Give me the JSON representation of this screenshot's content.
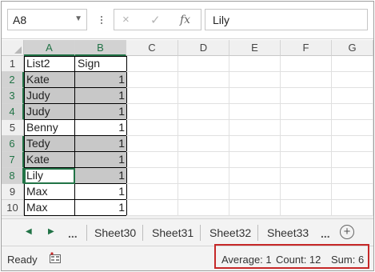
{
  "formula_bar": {
    "name_box": "A8",
    "cancel_icon": "×",
    "enter_icon": "✓",
    "fx_label": "fx",
    "content": "Lily"
  },
  "columns": [
    "A",
    "B",
    "C",
    "D",
    "E",
    "F",
    "G"
  ],
  "rows": [
    {
      "num": "1",
      "a": "List2",
      "b": "Sign",
      "shaded": false
    },
    {
      "num": "2",
      "a": "Kate",
      "b": "1",
      "shaded": true
    },
    {
      "num": "3",
      "a": "Judy",
      "b": "1",
      "shaded": true
    },
    {
      "num": "4",
      "a": "Judy",
      "b": "1",
      "shaded": true
    },
    {
      "num": "5",
      "a": "Benny",
      "b": "1",
      "shaded": false
    },
    {
      "num": "6",
      "a": "Tedy",
      "b": "1",
      "shaded": true
    },
    {
      "num": "7",
      "a": "Kate",
      "b": "1",
      "shaded": true
    },
    {
      "num": "8",
      "a": "Lily",
      "b": "1",
      "shaded": true
    },
    {
      "num": "9",
      "a": "Max",
      "b": "1",
      "shaded": false
    },
    {
      "num": "10",
      "a": "Max",
      "b": "1",
      "shaded": false
    }
  ],
  "selection": {
    "active_cell": "A8",
    "selected_columns": [
      "A",
      "B"
    ],
    "selected_rows": [
      "2",
      "3",
      "4",
      "6",
      "7",
      "8"
    ]
  },
  "tabs": {
    "prev_icon": "◀",
    "next_icon": "▶",
    "ellipsis_left": "...",
    "ellipsis_right": "...",
    "sheets": [
      "Sheet30",
      "Sheet31",
      "Sheet32",
      "Sheet33"
    ],
    "add_icon": "+"
  },
  "status": {
    "ready": "Ready",
    "average": "Average: 1",
    "count": "Count: 12",
    "sum": "Sum: 6"
  },
  "colors": {
    "accent": "#217346",
    "selection_fill": "#c8c8c8",
    "highlight_box": "#c62828"
  }
}
